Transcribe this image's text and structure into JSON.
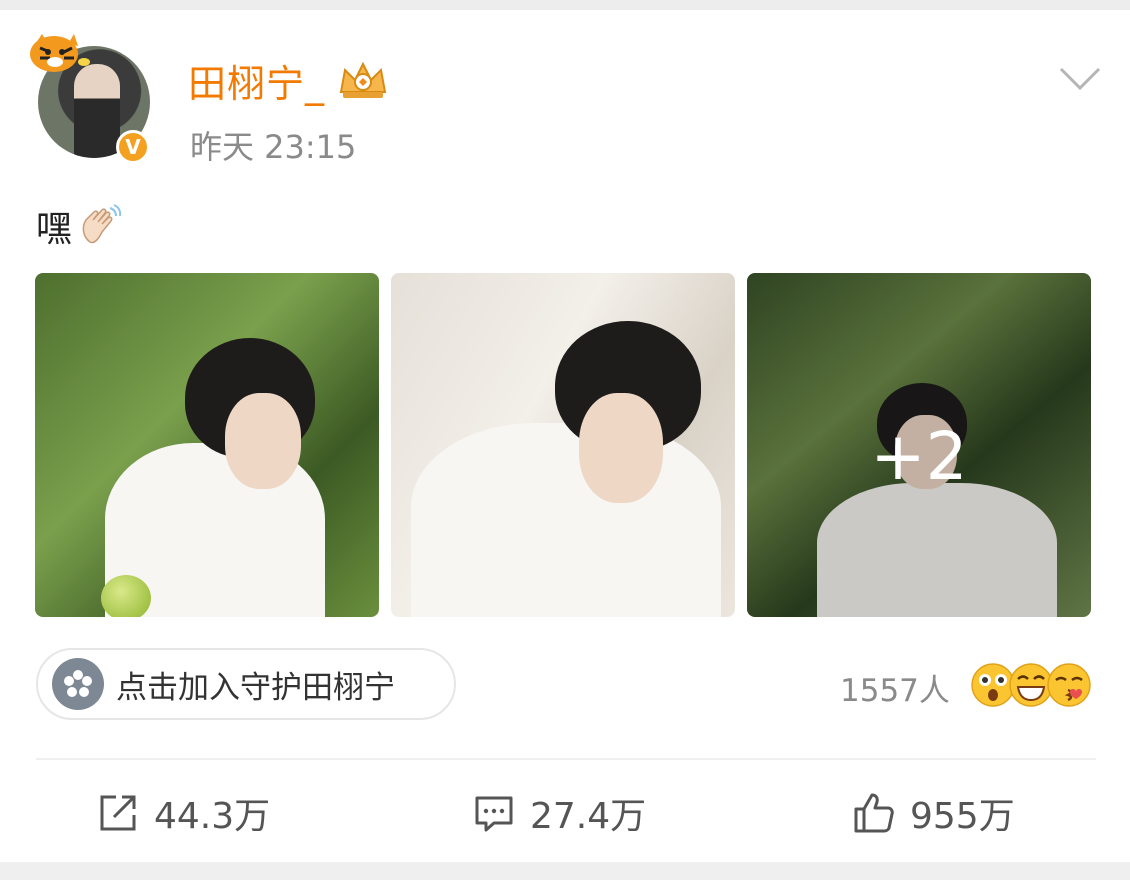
{
  "author": {
    "name": "田栩宁_",
    "verified_badge": "V",
    "timestamp": "昨天 23:15"
  },
  "post": {
    "text": "嘿",
    "emoji": "waving-hand",
    "images": [
      {
        "name": "photo-1"
      },
      {
        "name": "photo-2"
      },
      {
        "name": "photo-3",
        "more_count_label": "+2"
      }
    ]
  },
  "guard": {
    "label": "点击加入守护田栩宁"
  },
  "reactions": {
    "count_label": "1557人",
    "emojis": [
      "shocked-face",
      "grinning-face",
      "kissing-face"
    ]
  },
  "actions": {
    "share_count": "44.3万",
    "comment_count": "27.4万",
    "like_count": "955万"
  },
  "colors": {
    "username": "#f27a00",
    "verified": "#f4a021",
    "meta_text": "#8a8a8a"
  }
}
